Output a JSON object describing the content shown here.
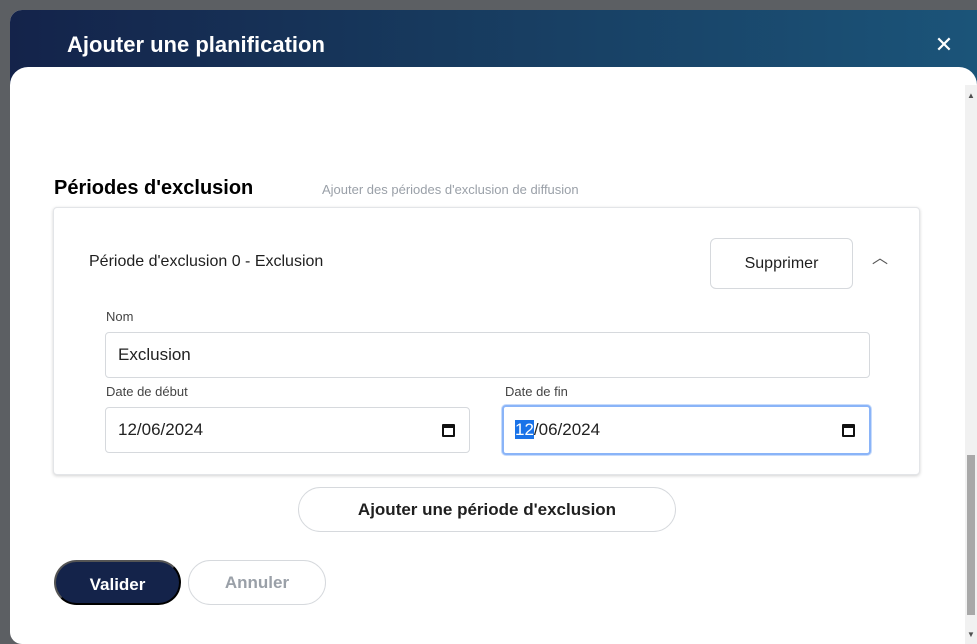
{
  "modal": {
    "title": "Ajouter une planification",
    "close_label": "✕"
  },
  "section": {
    "title": "Périodes d'exclusion",
    "hint": "Ajouter des périodes d'exclusion de diffusion"
  },
  "periods": [
    {
      "title": "Période d'exclusion 0 - Exclusion",
      "delete_label": "Supprimer",
      "name_label": "Nom",
      "name_value": "Exclusion",
      "start_label": "Date de début",
      "start_value": "12/06/2024",
      "end_label": "Date de fin",
      "end_value_selected": "12",
      "end_value_rest": "/06/2024"
    }
  ],
  "actions": {
    "add_period_label": "Ajouter une période d'exclusion",
    "validate_label": "Valider",
    "cancel_label": "Annuler"
  },
  "colors": {
    "header_start": "#14234a",
    "header_end": "#1b5479",
    "primary_button": "#14234a",
    "focus_ring": "#8ab4f8"
  }
}
